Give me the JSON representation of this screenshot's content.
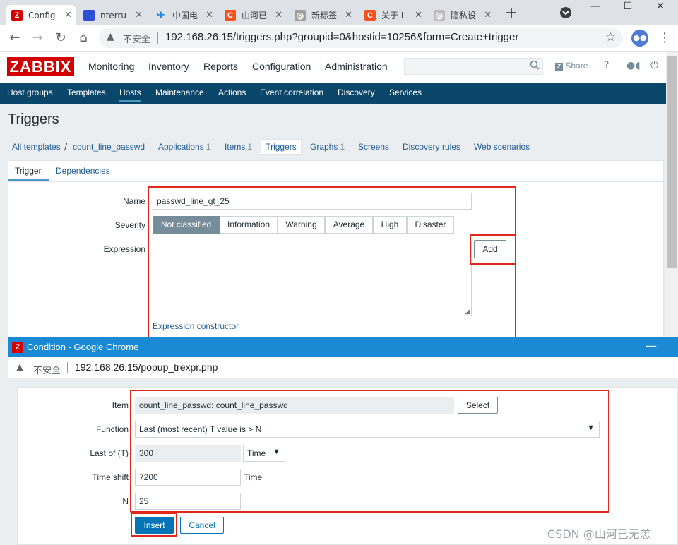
{
  "browser": {
    "tabs": [
      {
        "label": "Config",
        "favicon_letter": "Z",
        "favicon_color": "#d40000",
        "active": true
      },
      {
        "label": "nterru",
        "favicon_letter": "🐾",
        "favicon_color": "#2f4bd8"
      },
      {
        "label": "中国电",
        "favicon_letter": "✈",
        "favicon_color": "#1e88e5"
      },
      {
        "label": "山河已",
        "favicon_letter": "C",
        "favicon_color": "#f4511e"
      },
      {
        "label": "新标签",
        "favicon_letter": "◎",
        "favicon_color": "#9e9e9e"
      },
      {
        "label": "关于 L",
        "favicon_letter": "C",
        "favicon_color": "#f4511e"
      },
      {
        "label": "隐私设",
        "favicon_letter": "◎",
        "favicon_color": "#bdbdbd"
      }
    ],
    "new_tab": "+",
    "not_secure": "不安全",
    "url": "192.168.26.15/triggers.php?groupid=0&hostid=10256&form=Create+trigger"
  },
  "zabbix": {
    "logo": "ZABBIX",
    "top_nav": [
      "Monitoring",
      "Inventory",
      "Reports",
      "Configuration",
      "Administration"
    ],
    "share": "Share",
    "help": "?",
    "sub_nav": [
      "Host groups",
      "Templates",
      "Hosts",
      "Maintenance",
      "Actions",
      "Event correlation",
      "Discovery",
      "Services"
    ],
    "sub_nav_selected": "Hosts",
    "page_title": "Triggers",
    "breadcrumbs": {
      "all_templates": "All templates",
      "separator": "/",
      "template": "count_line_passwd",
      "applications": "Applications",
      "applications_count": "1",
      "items": "Items",
      "items_count": "1",
      "triggers": "Triggers",
      "graphs": "Graphs",
      "graphs_count": "1",
      "screens": "Screens",
      "discovery_rules": "Discovery rules",
      "web_scenarios": "Web scenarios"
    },
    "form_tabs": {
      "trigger": "Trigger",
      "dependencies": "Dependencies"
    },
    "form": {
      "name_label": "Name",
      "name_value": "passwd_line_gt_25",
      "severity_label": "Severity",
      "severities": [
        "Not classified",
        "Information",
        "Warning",
        "Average",
        "High",
        "Disaster"
      ],
      "severity_selected": "Not classified",
      "expression_label": "Expression",
      "expression_value": "",
      "add_button": "Add",
      "expression_constructor": "Expression constructor"
    }
  },
  "popup": {
    "window_title": "Condition - Google Chrome",
    "favicon_letter": "Z",
    "not_secure": "不安全",
    "url": "192.168.26.15/popup_trexpr.php",
    "item_label": "Item",
    "item_value": "count_line_passwd: count_line_passwd",
    "select_button": "Select",
    "function_label": "Function",
    "function_value": "Last (most recent) T value is > N",
    "last_of_label": "Last of (T)",
    "last_of_value": "300",
    "last_of_unit": "Time",
    "time_shift_label": "Time shift",
    "time_shift_value": "7200",
    "time_shift_unit": "Time",
    "n_label": "N",
    "n_value": "25",
    "insert_button": "Insert",
    "cancel_button": "Cancel"
  },
  "watermark": "CSDN @山河已无恙",
  "colors": {
    "highlight": "#e1261c",
    "brand_red": "#d40000",
    "nav_blue": "#0a466a",
    "primary": "#0275b8"
  }
}
